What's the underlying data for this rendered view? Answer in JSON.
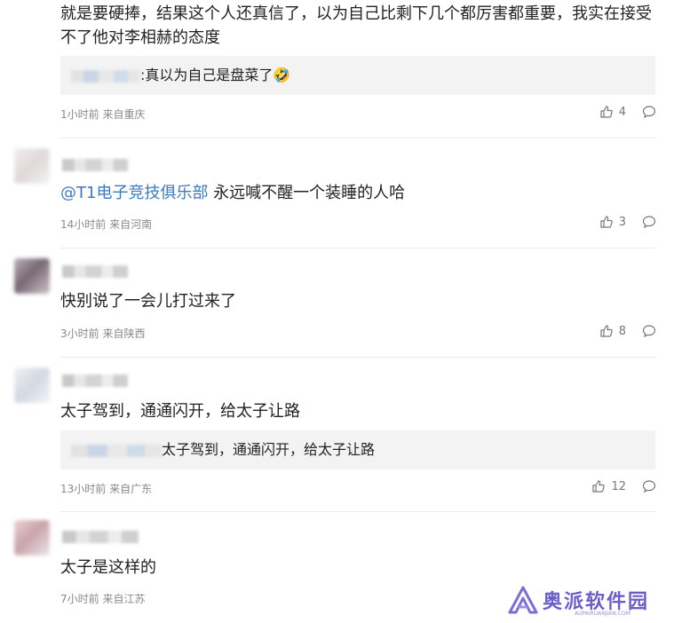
{
  "comments": [
    {
      "text": "就是要硬捧，结果这个人还真信了，以为自己比剩下几个都厉害都重要，我实在接受不了他对李相赫的态度",
      "reply": {
        "text": ":真以为自己是盘菜了🤣"
      },
      "meta": "1小时前 来自重庆",
      "likes": "4"
    },
    {
      "mention": "@T1电子竞技俱乐部",
      "text": " 永远喊不醒一个装睡的人哈",
      "meta": "14小时前 来自河南",
      "likes": "3"
    },
    {
      "text": "快别说了一会儿打过来了",
      "meta": "3小时前 来自陕西",
      "likes": "8"
    },
    {
      "text": "太子驾到，通通闪开，给太子让路",
      "reply": {
        "text": "太子驾到，通通闪开，给太子让路"
      },
      "meta": "13小时前 来自广东",
      "likes": "12"
    },
    {
      "text": "太子是这样的",
      "meta": "7小时前 来自江苏"
    }
  ],
  "watermark": {
    "text": "奥派软件园",
    "sub": "AUPAIRUANJIAN.COM",
    "color": "#6b5ec9"
  },
  "icons": {
    "like": "thumbs-up-icon",
    "comment": "speech-bubble-icon"
  }
}
